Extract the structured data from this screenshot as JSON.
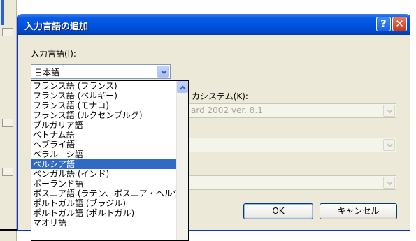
{
  "dialog": {
    "title": "入力言語の追加",
    "help_button": "?",
    "close_button": "✕",
    "input_language_label": "入力言語(I):",
    "input_language_value": "日本語",
    "keyboard_layout_label": "カシステム(K):",
    "keyboard_layout_value": "ard 2002 ver. 8.1",
    "ok_label": "OK",
    "cancel_label": "キャンセル"
  },
  "dropdown": {
    "items": [
      "フランス語 (フランス)",
      "フランス語 (ベルギー)",
      "フランス語 (モナコ)",
      "フランス語 (ルクセンブルグ)",
      "ブルガリア語",
      "ベトナム語",
      "ヘブライ語",
      "ベラルーシ語",
      "ペルシア語",
      "ベンガル語 (インド)",
      "ポーランド語",
      "ボスニア語 (ラテン、ボスニア・ヘルツ",
      "ポルトガル語 (ブラジル)",
      "ポルトガル語 (ポルトガル)",
      "マオリ語"
    ],
    "selected_index": 8
  },
  "colors": {
    "titlebar": "#0054e3",
    "selection": "#316ac5",
    "dialog_bg": "#ece9d8"
  }
}
